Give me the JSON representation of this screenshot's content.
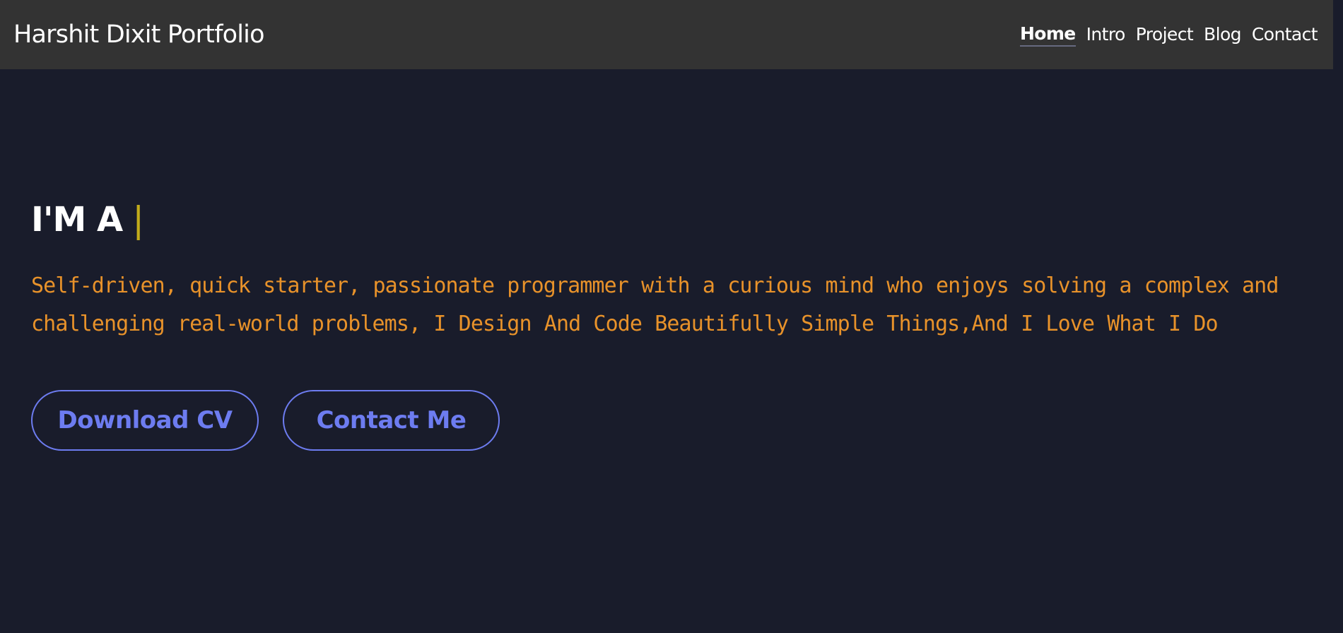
{
  "navbar": {
    "brand": "Harshit Dixit Portfolio",
    "links": [
      {
        "label": "Home",
        "active": true
      },
      {
        "label": "Intro",
        "active": false
      },
      {
        "label": "Project",
        "active": false
      },
      {
        "label": "Blog",
        "active": false
      },
      {
        "label": "Contact",
        "active": false
      }
    ]
  },
  "hero": {
    "headline": "I'M A",
    "cursor": "|",
    "description": "Self-driven, quick starter, passionate programmer with a curious mind who enjoys solving a complex and challenging real-world problems, I Design And Code Beautifully Simple Things,And I Love What I Do",
    "buttons": {
      "download_cv": "Download CV",
      "contact_me": "Contact Me"
    }
  },
  "colors": {
    "background": "#191c2b",
    "navbar": "#333333",
    "accent_orange": "#e8922a",
    "accent_blue": "#6d7cf0",
    "cursor_yellow": "#c2ac1a"
  }
}
